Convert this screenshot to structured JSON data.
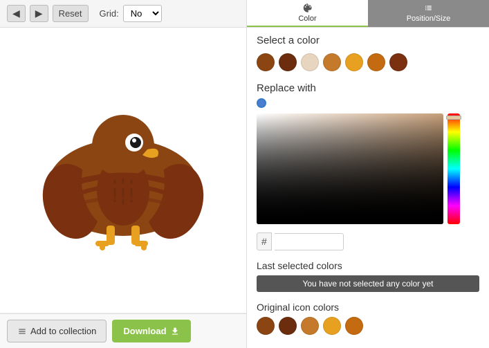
{
  "toolbar": {
    "back_label": "◀",
    "forward_label": "▶",
    "reset_label": "Reset",
    "grid_label": "Grid:",
    "grid_value": "No"
  },
  "tabs": [
    {
      "id": "color",
      "label": "Color",
      "icon": "palette-icon",
      "active": true
    },
    {
      "id": "position",
      "label": "Position/Size",
      "icon": "position-icon",
      "active": false
    }
  ],
  "color_panel": {
    "select_title": "Select a color",
    "swatches": [
      {
        "color": "#8B4513",
        "id": "s1"
      },
      {
        "color": "#6B2D0E",
        "id": "s2"
      },
      {
        "color": "#E8D5C0",
        "id": "s3"
      },
      {
        "color": "#C47A2A",
        "id": "s4"
      },
      {
        "color": "#E8A020",
        "id": "s5"
      },
      {
        "color": "#C46A10",
        "id": "s6"
      },
      {
        "color": "#7B3010",
        "id": "s7"
      }
    ],
    "replace_title": "Replace with",
    "hex_hash": "#",
    "hex_placeholder": "",
    "last_selected_title": "Last selected colors",
    "no_color_msg": "You have not selected any color yet",
    "original_title": "Original icon colors",
    "original_swatches": [
      {
        "color": "#8B4513",
        "id": "o1"
      },
      {
        "color": "#6B2D0E",
        "id": "o2"
      },
      {
        "color": "#C47A2A",
        "id": "o3"
      },
      {
        "color": "#E8A020",
        "id": "o4"
      },
      {
        "color": "#C46A10",
        "id": "o5"
      }
    ]
  },
  "actions": {
    "add_label": "Add to collection",
    "download_label": "Download"
  }
}
